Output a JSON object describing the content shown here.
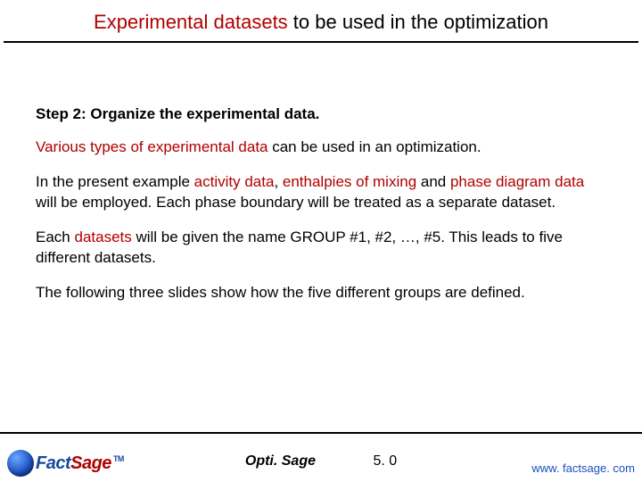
{
  "title": {
    "red": "Experimental datasets",
    "rest": " to be used in the optimization"
  },
  "step_heading": "Step 2: Organize the experimental data.",
  "p1": {
    "red": "Various types of experimental data",
    "rest": " can be used in an optimization."
  },
  "p2": {
    "a": "In the present example ",
    "r1": "activity data",
    "b": ", ",
    "r2": "enthalpies of mixing",
    "c": " and ",
    "r3": "phase diagram data",
    "d": " will be employed. Each phase boundary will be treated as a separate dataset."
  },
  "p3": {
    "a": "Each ",
    "r1": "datasets",
    "b": " will be given the name GROUP #1, #2, …, #5. This leads to five different datasets."
  },
  "p4": "The following three slides show how the five different groups are defined.",
  "footer": {
    "logo_fact": "Fact",
    "logo_sage": "Sage",
    "tm": "TM",
    "product": "Opti. Sage",
    "page": "5. 0",
    "url": "www. factsage. com"
  }
}
